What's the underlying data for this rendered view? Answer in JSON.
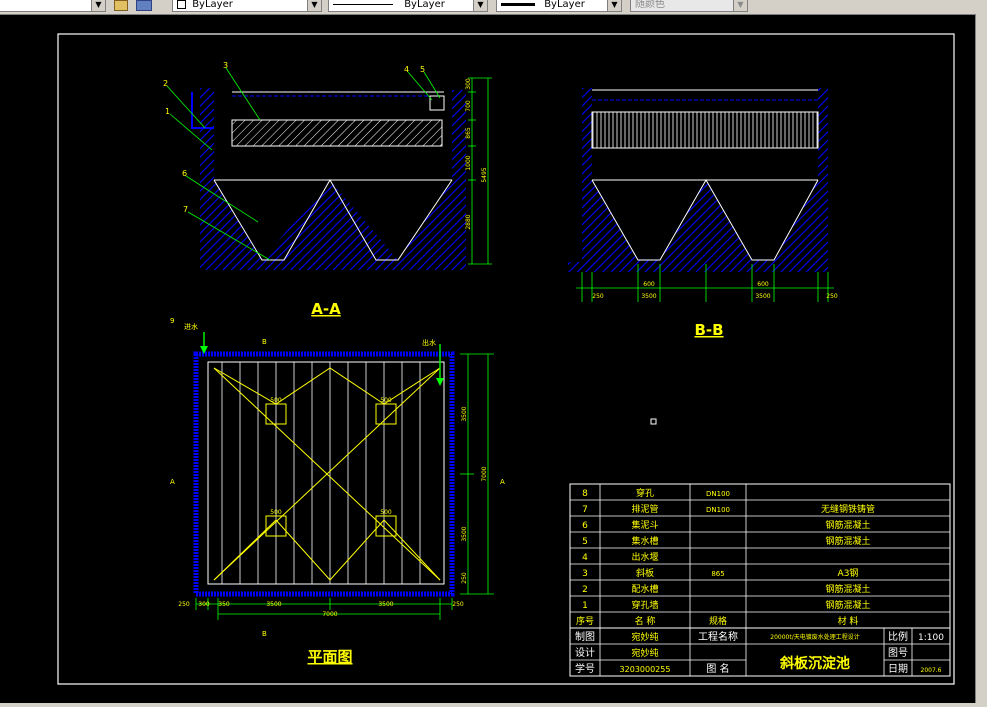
{
  "toolbar": {
    "layer_state": "",
    "color_combo": "ByLayer",
    "linetype_combo": "ByLayer",
    "lineweight_combo": "ByLayer",
    "plotstyle_combo": "随颜色"
  },
  "drawing": {
    "section_aa_title": "A-A",
    "section_bb_title": "B-B",
    "plan_title": "平面图",
    "section_aa": {
      "callouts": [
        "1",
        "2",
        "3",
        "4",
        "5",
        "6",
        "7"
      ],
      "dims_vertical": [
        "300",
        "700",
        "865",
        "1000",
        "2880"
      ],
      "dim_total": "5495"
    },
    "section_bb": {
      "dims_bottom": [
        "250",
        "600",
        "3500",
        "600",
        "3500",
        "250"
      ]
    },
    "plan": {
      "inlet_label": "进水",
      "outlet_label": "出水",
      "callout_9": "9",
      "section_mark_b": "B",
      "section_mark_a": "A",
      "hopper_size": "500",
      "dims_right": [
        "3500",
        "7000",
        "3500",
        "250"
      ],
      "dims_bottom": [
        "250",
        "300",
        "350",
        "3500",
        "3500",
        "250"
      ],
      "dim_bottom_total": "7000"
    }
  },
  "parts_table": {
    "rows": [
      {
        "no": "8",
        "name": "穿孔",
        "spec": "DN100",
        "material": ""
      },
      {
        "no": "7",
        "name": "排泥管",
        "spec": "DN100",
        "material": "无缝钢铁铸管"
      },
      {
        "no": "6",
        "name": "集泥斗",
        "spec": "",
        "material": "钢筋混凝土"
      },
      {
        "no": "5",
        "name": "集水槽",
        "spec": "",
        "material": "钢筋混凝土"
      },
      {
        "no": "4",
        "name": "出水堰",
        "spec": "",
        "material": ""
      },
      {
        "no": "3",
        "name": "斜板",
        "spec": "865",
        "material": "A3钢"
      },
      {
        "no": "2",
        "name": "配水槽",
        "spec": "",
        "material": "钢筋混凝土"
      },
      {
        "no": "1",
        "name": "穿孔墙",
        "spec": "",
        "material": "钢筋混凝土"
      }
    ],
    "header": {
      "no": "序号",
      "name": "名 称",
      "spec": "规格",
      "material": "材 料"
    }
  },
  "title_block": {
    "drawn_by_label": "制图",
    "drawn_by": "宛妙纯",
    "project_label": "工程名称",
    "project": "20000t/天电镀废水处理工程设计",
    "scale_label": "比例",
    "scale": "1:100",
    "design_label": "设计",
    "designer": "宛妙纯",
    "sheet_label": "图号",
    "sheet": "",
    "student_label": "学号",
    "student_no": "3203000255",
    "drawing_name_label": "图 名",
    "drawing_name": "斜板沉淀池",
    "date_label": "日期",
    "date": "2007.6"
  },
  "colors": {
    "frame": "#ffffff",
    "structure": "#0000ff",
    "dimension": "#00ff00",
    "plates": "#ffff00",
    "leader": "#00ff00",
    "text": "#ffff00",
    "toolbar_bg": "#d4d0c8"
  }
}
